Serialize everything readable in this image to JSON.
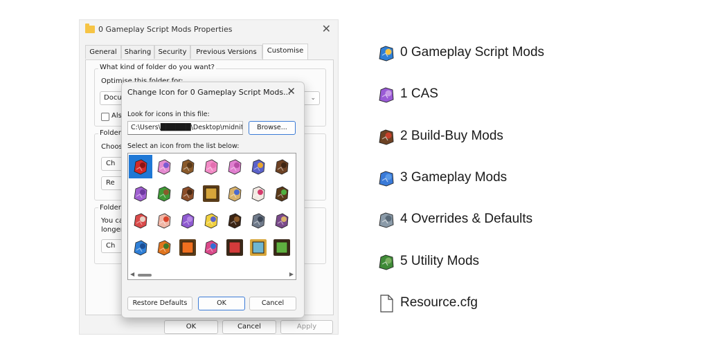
{
  "properties_window": {
    "title": "0 Gameplay Script Mods Properties",
    "close_glyph": "✕",
    "tabs": [
      {
        "label": "General"
      },
      {
        "label": "Sharing"
      },
      {
        "label": "Security"
      },
      {
        "label": "Previous Versions"
      },
      {
        "label": "Customise"
      }
    ],
    "active_tab": "Customise",
    "section1_heading": "What kind of folder do you want?",
    "optimise_label": "Optimise this folder for:",
    "optimise_value": "Docu",
    "also_apply_label": "Als",
    "section2_heading": "Folder",
    "choose_label": "Choos",
    "choose_button": "Ch",
    "restore_button": "Re",
    "section3_heading": "Folder",
    "section3_text_1": "You ca",
    "section3_text_2": "longer",
    "change_icon_button": "Ch",
    "ok_button": "OK",
    "cancel_button": "Cancel",
    "apply_button": "Apply"
  },
  "change_icon_dialog": {
    "title": "Change Icon for 0 Gameplay Script Mods...",
    "close_glyph": "✕",
    "look_for_label": "Look for icons in this file:",
    "path_value": "C:\\Users\\██████\\Desktop\\midnitetech",
    "browse_button": "Browse...",
    "select_label": "Select an icon from the list below:",
    "selected_index": 0,
    "icons": [
      "red-puzzle-icon",
      "pink-dress-icon",
      "wooden-desk-icon",
      "pink-paint-icon",
      "pink-animal-icon",
      "blue-toys-icon",
      "brown-horse-icon",
      "purple-sim-icon",
      "green-trees-icon",
      "brown-dog-icon",
      "gold-frame-icon",
      "tan-table-icon",
      "white-alien-icon",
      "green-sprout-icon",
      "landscape-frame-icon",
      "ticket-hand-icon",
      "white-card-icon",
      "purple-hand-icon",
      "tools-icon",
      "horse-dark-icon",
      "gray-wolf-icon",
      "vanity-desk-icon",
      "blue-puzzle-icon",
      "pumpkin-icon",
      "fire-frame-icon",
      "phone-icon",
      "gnome-frame-icon",
      "portrait-frame-icon",
      "frog-frame-icon"
    ],
    "restore_defaults_button": "Restore Defaults",
    "ok_button": "OK",
    "cancel_button": "Cancel"
  },
  "file_list": [
    {
      "name": "0 Gameplay Script Mods",
      "icon": "blue-puzzle-folder-icon"
    },
    {
      "name": "1 CAS",
      "icon": "purple-hand-folder-icon"
    },
    {
      "name": "2 Build-Buy Mods",
      "icon": "house-folder-icon"
    },
    {
      "name": "3 Gameplay Mods",
      "icon": "blue-gamepad-folder-icon"
    },
    {
      "name": "4 Overrides & Defaults",
      "icon": "wrench-folder-icon"
    },
    {
      "name": "5 Utility Mods",
      "icon": "green-plants-folder-icon"
    },
    {
      "name": "Resource.cfg",
      "icon": "document-file-icon"
    }
  ],
  "colors": {
    "window_bg": "#f3f3f3",
    "panel_bg": "#fbfbfb",
    "accent": "#1f78d6",
    "folder_yellow": "#f6c445"
  }
}
